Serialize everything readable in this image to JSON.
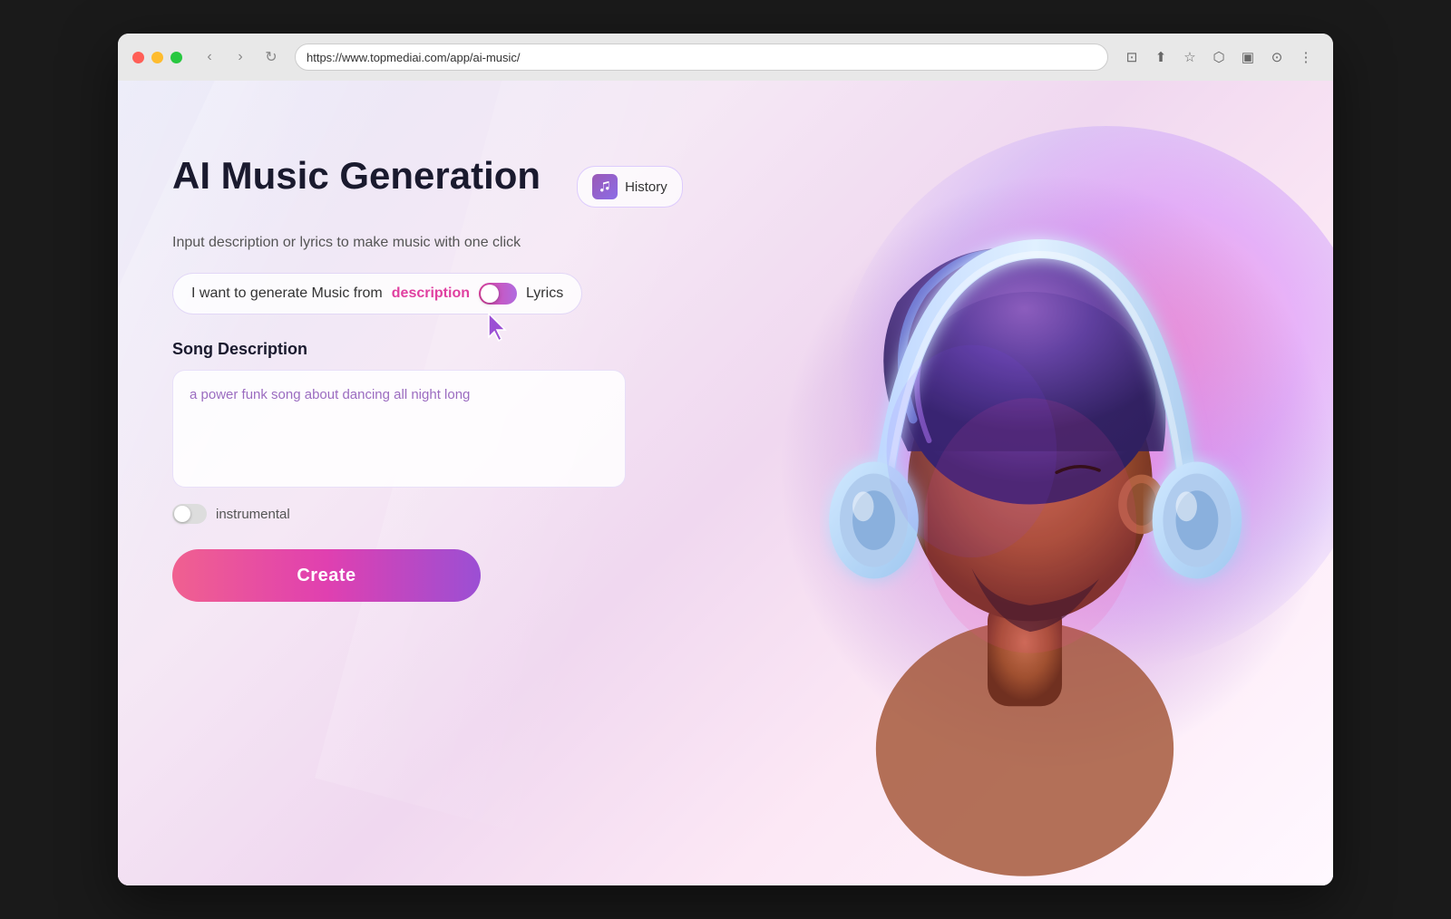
{
  "browser": {
    "url": "https://www.topmediai.com/app/ai-music/",
    "back_btn": "‹",
    "forward_btn": "›",
    "refresh_btn": "↻"
  },
  "page": {
    "title": "AI Music Generation",
    "history_label": "History",
    "subtitle": "Input description or lyrics to make music with one click",
    "toggle_prefix": "I want to generate  Music from",
    "toggle_description": "description",
    "toggle_lyrics": "Lyrics",
    "section_label": "Song Description",
    "textarea_placeholder": "a power funk song about dancing all night long",
    "textarea_value": "a power funk song about dancing all night long",
    "instrumental_label": "instrumental",
    "create_label": "Create"
  }
}
